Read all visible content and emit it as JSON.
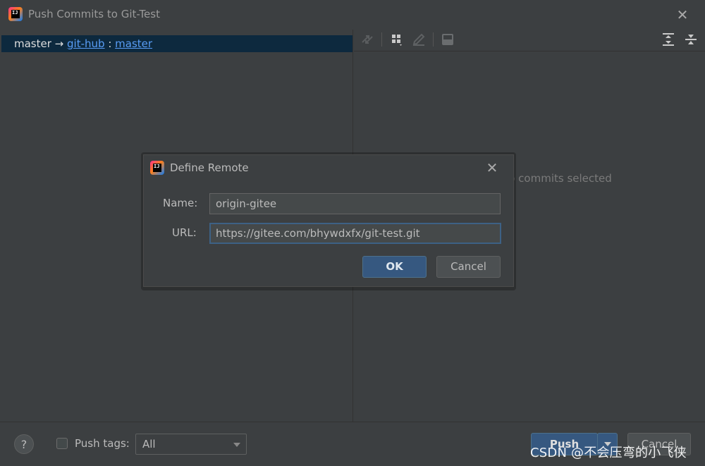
{
  "window": {
    "title": "Push Commits to Git-Test",
    "logo_text": "IJ"
  },
  "left_panel": {
    "branch": {
      "local": "master",
      "arrow": " → ",
      "remote": "git-hub",
      "sep": " : ",
      "remote_branch": "master"
    }
  },
  "right_panel": {
    "toolbar_icons": [
      "cherry-pick-icon",
      "group-by-icon",
      "edit-icon",
      "preview-icon",
      "expand-all-icon",
      "collapse-all-icon"
    ],
    "empty_text": "No commits selected"
  },
  "footer": {
    "help_label": "?",
    "push_tags_label": "Push tags:",
    "push_tags_checked": false,
    "tags_select_value": "All",
    "push_label": "Push",
    "cancel_label": "Cancel",
    "watermark": "CSDN @不会压弯的小飞侠"
  },
  "dialog": {
    "title": "Define Remote",
    "logo_text": "IJ",
    "name_label": "Name:",
    "name_value": "origin-gitee",
    "url_label": "URL:",
    "url_value": "https://gitee.com/bhywdxfx/git-test.git",
    "ok_label": "OK",
    "cancel_label": "Cancel"
  },
  "colors": {
    "background": "#3c3f41",
    "selection": "#0d293e",
    "link": "#589df6",
    "primary_button": "#365880"
  }
}
